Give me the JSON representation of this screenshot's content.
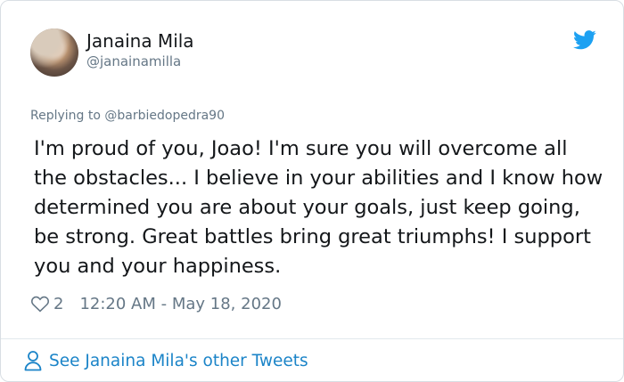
{
  "author": {
    "name": "Janaina Mila",
    "handle": "@janainamilla"
  },
  "reply": {
    "prefix": "Replying to ",
    "mention": "@barbiedopedra90"
  },
  "tweet": {
    "text": "I'm proud of you, Joao! I'm sure you will overcome all the obstacles... I believe in your abilities and I know how determined you are about your goals, just keep going, be strong. Great battles bring great triumphs! I support you and your happiness."
  },
  "meta": {
    "likes": "2",
    "timestamp": "12:20 AM - May 18, 2020"
  },
  "footer": {
    "label": "See Janaina Mila's other Tweets"
  },
  "icons": {
    "brand": "twitter-bird-icon",
    "like": "heart-icon",
    "profile": "person-icon"
  },
  "colors": {
    "twitter_blue": "#1da1f2",
    "link": "#1b84c8",
    "muted": "#657786",
    "text": "#14171a"
  }
}
